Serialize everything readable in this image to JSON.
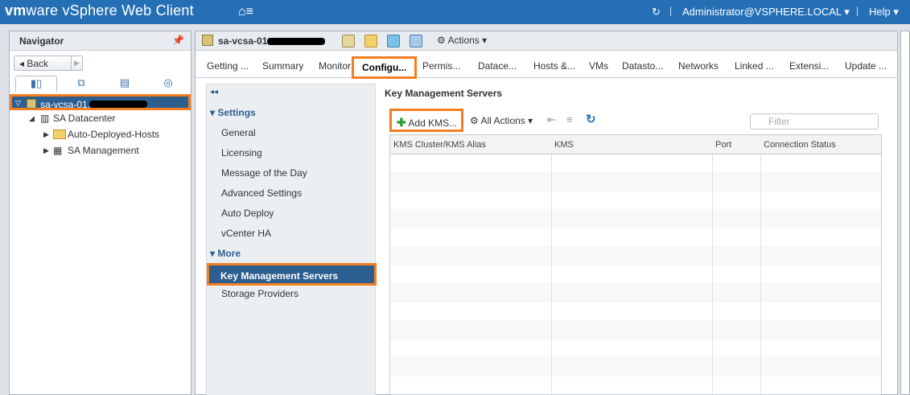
{
  "header": {
    "brand_vm": "vm",
    "brand_ware": "ware",
    "product": " vSphere Web Client",
    "user": "Administrator@VSPHERE.LOCAL ▾",
    "help": "Help ▾"
  },
  "navigator": {
    "title": "Navigator",
    "back_label": "Back",
    "tree": [
      {
        "label": "sa-vcsa-01."
      },
      {
        "label": "SA Datacenter"
      },
      {
        "label": "Auto-Deployed-Hosts"
      },
      {
        "label": "SA Management"
      }
    ]
  },
  "object": {
    "title": "sa-vcsa-01",
    "actions_label": "Actions ▾"
  },
  "tabs": [
    "Getting ...",
    "Summary",
    "Monitor",
    "Configu...",
    "Permis...",
    "Datace...",
    "Hosts &...",
    "VMs",
    "Datasto...",
    "Networks",
    "Linked ...",
    "Extensi...",
    "Update ..."
  ],
  "submenu": {
    "settings": "Settings",
    "settings_items": [
      "General",
      "Licensing",
      "Message of the Day",
      "Advanced Settings",
      "Auto Deploy",
      "vCenter HA"
    ],
    "more": "More",
    "more_items": [
      "Key Management Servers",
      "Storage Providers"
    ]
  },
  "kms": {
    "title": "Key Management Servers",
    "add_label": "Add KMS...",
    "all_actions": "All Actions ▾",
    "filter_placeholder": "Filter",
    "columns": [
      "KMS Cluster/KMS Alias",
      "KMS",
      "Port",
      "Connection Status"
    ]
  },
  "colors": {
    "header": "#256fb5",
    "selected": "#2c5e8f",
    "highlight": "#f47e20"
  }
}
